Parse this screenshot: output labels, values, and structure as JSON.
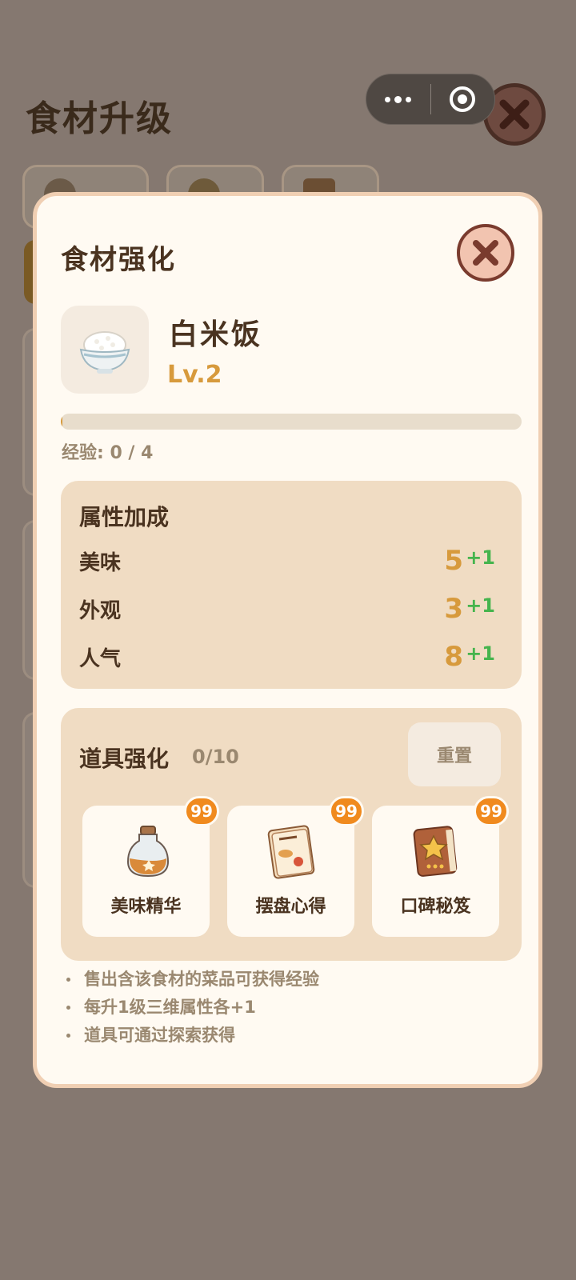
{
  "background": {
    "page_title": "食材升级"
  },
  "modal": {
    "title": "食材强化",
    "food": {
      "name": "白米饭",
      "level": "Lv.2",
      "icon": "rice-bowl-icon"
    },
    "experience": {
      "text": "经验: 0 / 4",
      "progress": 0.0
    },
    "attributes": {
      "title": "属性加成",
      "rows": [
        {
          "name": "美味",
          "value": "5",
          "bonus": "+1"
        },
        {
          "name": "外观",
          "value": "3",
          "bonus": "+1"
        },
        {
          "name": "人气",
          "value": "8",
          "bonus": "+1"
        }
      ]
    },
    "tools": {
      "title": "道具强化",
      "count": "0/10",
      "reset_label": "重置",
      "items": [
        {
          "label": "美味精华",
          "badge": "99",
          "icon": "potion-bottle-icon"
        },
        {
          "label": "摆盘心得",
          "badge": "99",
          "icon": "menu-book-icon"
        },
        {
          "label": "口碑秘笈",
          "badge": "99",
          "icon": "star-book-icon"
        }
      ]
    },
    "tips": [
      "售出含该食材的菜品可获得经验",
      "每升1级三维属性各+1",
      "道具可通过探索获得"
    ]
  },
  "colors": {
    "accent": "#d79a3c",
    "bonus_green": "#45b44d",
    "badge_orange": "#f08a1e",
    "panel": "#f0dcc3",
    "modal_bg": "#fffaf2"
  }
}
